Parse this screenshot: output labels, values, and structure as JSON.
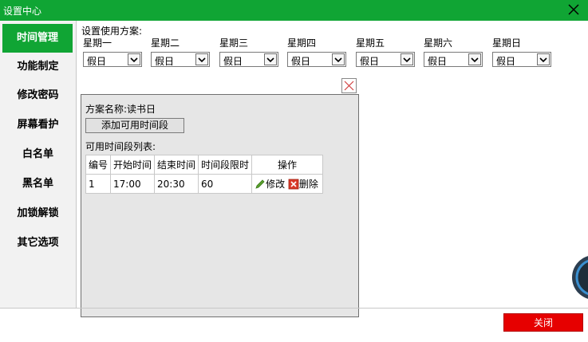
{
  "window": {
    "title": "设置中心"
  },
  "sidebar": {
    "items": [
      {
        "label": "时间管理"
      },
      {
        "label": "功能制定"
      },
      {
        "label": "修改密码"
      },
      {
        "label": "屏幕看护"
      },
      {
        "label": "白名单"
      },
      {
        "label": "黑名单"
      },
      {
        "label": "加锁解锁"
      },
      {
        "label": "其它选项"
      }
    ]
  },
  "schedule": {
    "label": "设置使用方案:",
    "days": [
      {
        "day": "星期一",
        "value": "假日"
      },
      {
        "day": "星期二",
        "value": "假日"
      },
      {
        "day": "星期三",
        "value": "假日"
      },
      {
        "day": "星期四",
        "value": "假日"
      },
      {
        "day": "星期五",
        "value": "假日"
      },
      {
        "day": "星期六",
        "value": "假日"
      },
      {
        "day": "星期日",
        "value": "假日"
      }
    ]
  },
  "panel": {
    "name_label": "方案名称:读书日",
    "add_button": "添加可用时间段",
    "list_label": "可用时间段列表:",
    "columns": [
      "编号",
      "开始时间",
      "结束时间",
      "时间段限时",
      "操作"
    ],
    "rows": [
      {
        "id": "1",
        "start": "17:00",
        "end": "20:30",
        "limit": "60",
        "edit": "修改",
        "delete": "删除"
      }
    ]
  },
  "footer": {
    "close_label": "关闭"
  },
  "colors": {
    "accent": "#10a534",
    "danger": "#e60000"
  },
  "icons": {
    "window_close": "close-icon",
    "panel_close": "close-icon",
    "edit": "pencil-icon",
    "delete": "delete-icon",
    "dropdown": "chevron-down-icon"
  }
}
